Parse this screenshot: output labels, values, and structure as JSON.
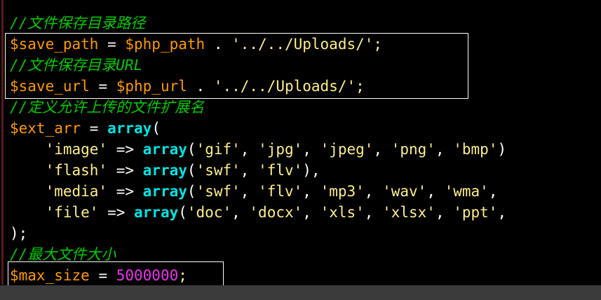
{
  "colors": {
    "background": "#000000",
    "comment": "#00cc00",
    "variable": "#ff9900",
    "string": "#ffee88",
    "operator": "#ffffff",
    "function": "#00e5e5",
    "number": "#ee33ee"
  },
  "lines": [
    {
      "tokens": [
        {
          "t": "c",
          "v": "//文件保存目录路径"
        }
      ]
    },
    {
      "tokens": [
        {
          "t": "v",
          "v": "$save_path"
        },
        {
          "t": "o",
          "v": " = "
        },
        {
          "t": "v",
          "v": "$php_path"
        },
        {
          "t": "o",
          "v": " . "
        },
        {
          "t": "s",
          "v": "'../../Uploads/'"
        },
        {
          "t": "pc",
          "v": ";"
        }
      ]
    },
    {
      "tokens": [
        {
          "t": "c",
          "v": "//文件保存目录URL"
        }
      ]
    },
    {
      "tokens": [
        {
          "t": "v",
          "v": "$save_url"
        },
        {
          "t": "o",
          "v": " = "
        },
        {
          "t": "v",
          "v": "$php_url"
        },
        {
          "t": "o",
          "v": " . "
        },
        {
          "t": "s",
          "v": "'../../Uploads/'"
        },
        {
          "t": "pc",
          "v": ";"
        }
      ]
    },
    {
      "tokens": [
        {
          "t": "c",
          "v": "//定义允许上传的文件扩展名"
        }
      ]
    },
    {
      "tokens": [
        {
          "t": "v",
          "v": "$ext_arr"
        },
        {
          "t": "o",
          "v": " = "
        },
        {
          "t": "f",
          "v": "array"
        },
        {
          "t": "o",
          "v": "("
        }
      ]
    },
    {
      "tokens": [
        {
          "t": "o",
          "v": "    "
        },
        {
          "t": "s",
          "v": "'image'"
        },
        {
          "t": "o",
          "v": " => "
        },
        {
          "t": "f",
          "v": "array"
        },
        {
          "t": "o",
          "v": "("
        },
        {
          "t": "s",
          "v": "'gif'"
        },
        {
          "t": "o",
          "v": ", "
        },
        {
          "t": "s",
          "v": "'jpg'"
        },
        {
          "t": "o",
          "v": ", "
        },
        {
          "t": "s",
          "v": "'jpeg'"
        },
        {
          "t": "o",
          "v": ", "
        },
        {
          "t": "s",
          "v": "'png'"
        },
        {
          "t": "o",
          "v": ", "
        },
        {
          "t": "s",
          "v": "'bmp'"
        },
        {
          "t": "o",
          "v": ")"
        }
      ]
    },
    {
      "tokens": [
        {
          "t": "o",
          "v": "    "
        },
        {
          "t": "s",
          "v": "'flash'"
        },
        {
          "t": "o",
          "v": " => "
        },
        {
          "t": "f",
          "v": "array"
        },
        {
          "t": "o",
          "v": "("
        },
        {
          "t": "s",
          "v": "'swf'"
        },
        {
          "t": "o",
          "v": ", "
        },
        {
          "t": "s",
          "v": "'flv'"
        },
        {
          "t": "o",
          "v": "),"
        }
      ]
    },
    {
      "tokens": [
        {
          "t": "o",
          "v": "    "
        },
        {
          "t": "s",
          "v": "'media'"
        },
        {
          "t": "o",
          "v": " => "
        },
        {
          "t": "f",
          "v": "array"
        },
        {
          "t": "o",
          "v": "("
        },
        {
          "t": "s",
          "v": "'swf'"
        },
        {
          "t": "o",
          "v": ", "
        },
        {
          "t": "s",
          "v": "'flv'"
        },
        {
          "t": "o",
          "v": ", "
        },
        {
          "t": "s",
          "v": "'mp3'"
        },
        {
          "t": "o",
          "v": ", "
        },
        {
          "t": "s",
          "v": "'wav'"
        },
        {
          "t": "o",
          "v": ", "
        },
        {
          "t": "s",
          "v": "'wma'"
        },
        {
          "t": "o",
          "v": ","
        }
      ]
    },
    {
      "tokens": [
        {
          "t": "o",
          "v": "    "
        },
        {
          "t": "s",
          "v": "'file'"
        },
        {
          "t": "o",
          "v": " => "
        },
        {
          "t": "f",
          "v": "array"
        },
        {
          "t": "o",
          "v": "("
        },
        {
          "t": "s",
          "v": "'doc'"
        },
        {
          "t": "o",
          "v": ", "
        },
        {
          "t": "s",
          "v": "'docx'"
        },
        {
          "t": "o",
          "v": ", "
        },
        {
          "t": "s",
          "v": "'xls'"
        },
        {
          "t": "o",
          "v": ", "
        },
        {
          "t": "s",
          "v": "'xlsx'"
        },
        {
          "t": "o",
          "v": ", "
        },
        {
          "t": "s",
          "v": "'ppt'"
        },
        {
          "t": "o",
          "v": ","
        }
      ]
    },
    {
      "tokens": [
        {
          "t": "o",
          "v": ");"
        }
      ]
    },
    {
      "tokens": [
        {
          "t": "c",
          "v": "//最大文件大小"
        }
      ]
    },
    {
      "tokens": [
        {
          "t": "v",
          "v": "$max_size"
        },
        {
          "t": "o",
          "v": " = "
        },
        {
          "t": "n",
          "v": "5000000"
        },
        {
          "t": "pc",
          "v": ";"
        }
      ]
    }
  ]
}
